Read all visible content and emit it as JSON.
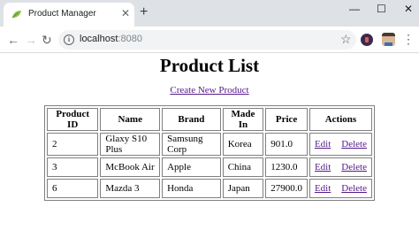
{
  "browser": {
    "tab_title": "Product Manager",
    "tab_close_glyph": "✕",
    "new_tab_glyph": "+",
    "url_host": "localhost",
    "url_port": ":8080",
    "icons": [
      "favicon-leaf-icon",
      "close-icon",
      "plus-icon",
      "minimize-icon",
      "maximize-icon",
      "close-window-icon",
      "back-arrow-icon",
      "forward-arrow-icon",
      "reload-icon",
      "info-icon",
      "star-icon",
      "extension-icon",
      "profile-avatar",
      "more-menu-icon"
    ],
    "controls": {
      "minimize": "—",
      "maximize": "☐",
      "close": "✕",
      "back": "←",
      "forward": "→",
      "reload": "↻",
      "info": "i",
      "star": "☆",
      "menu": "⋮"
    }
  },
  "page": {
    "title": "Product List",
    "create_link": "Create New Product"
  },
  "table": {
    "headers": [
      "Product ID",
      "Name",
      "Brand",
      "Made In",
      "Price",
      "Actions"
    ],
    "rows": [
      {
        "id": "2",
        "name": "Glaxy S10 Plus",
        "brand": "Samsung Corp",
        "made_in": "Korea",
        "price": "901.0",
        "edit": "Edit",
        "delete": "Delete"
      },
      {
        "id": "3",
        "name": "McBook Air",
        "brand": "Apple",
        "made_in": "China",
        "price": "1230.0",
        "edit": "Edit",
        "delete": "Delete"
      },
      {
        "id": "6",
        "name": "Mazda 3",
        "brand": "Honda",
        "made_in": "Japan",
        "price": "27900.0",
        "edit": "Edit",
        "delete": "Delete"
      }
    ]
  },
  "colors": {
    "tabstrip": "#dee1e6",
    "omnibox": "#f1f3f4",
    "visited_link": "#551a8b",
    "table_border": "#808080"
  }
}
